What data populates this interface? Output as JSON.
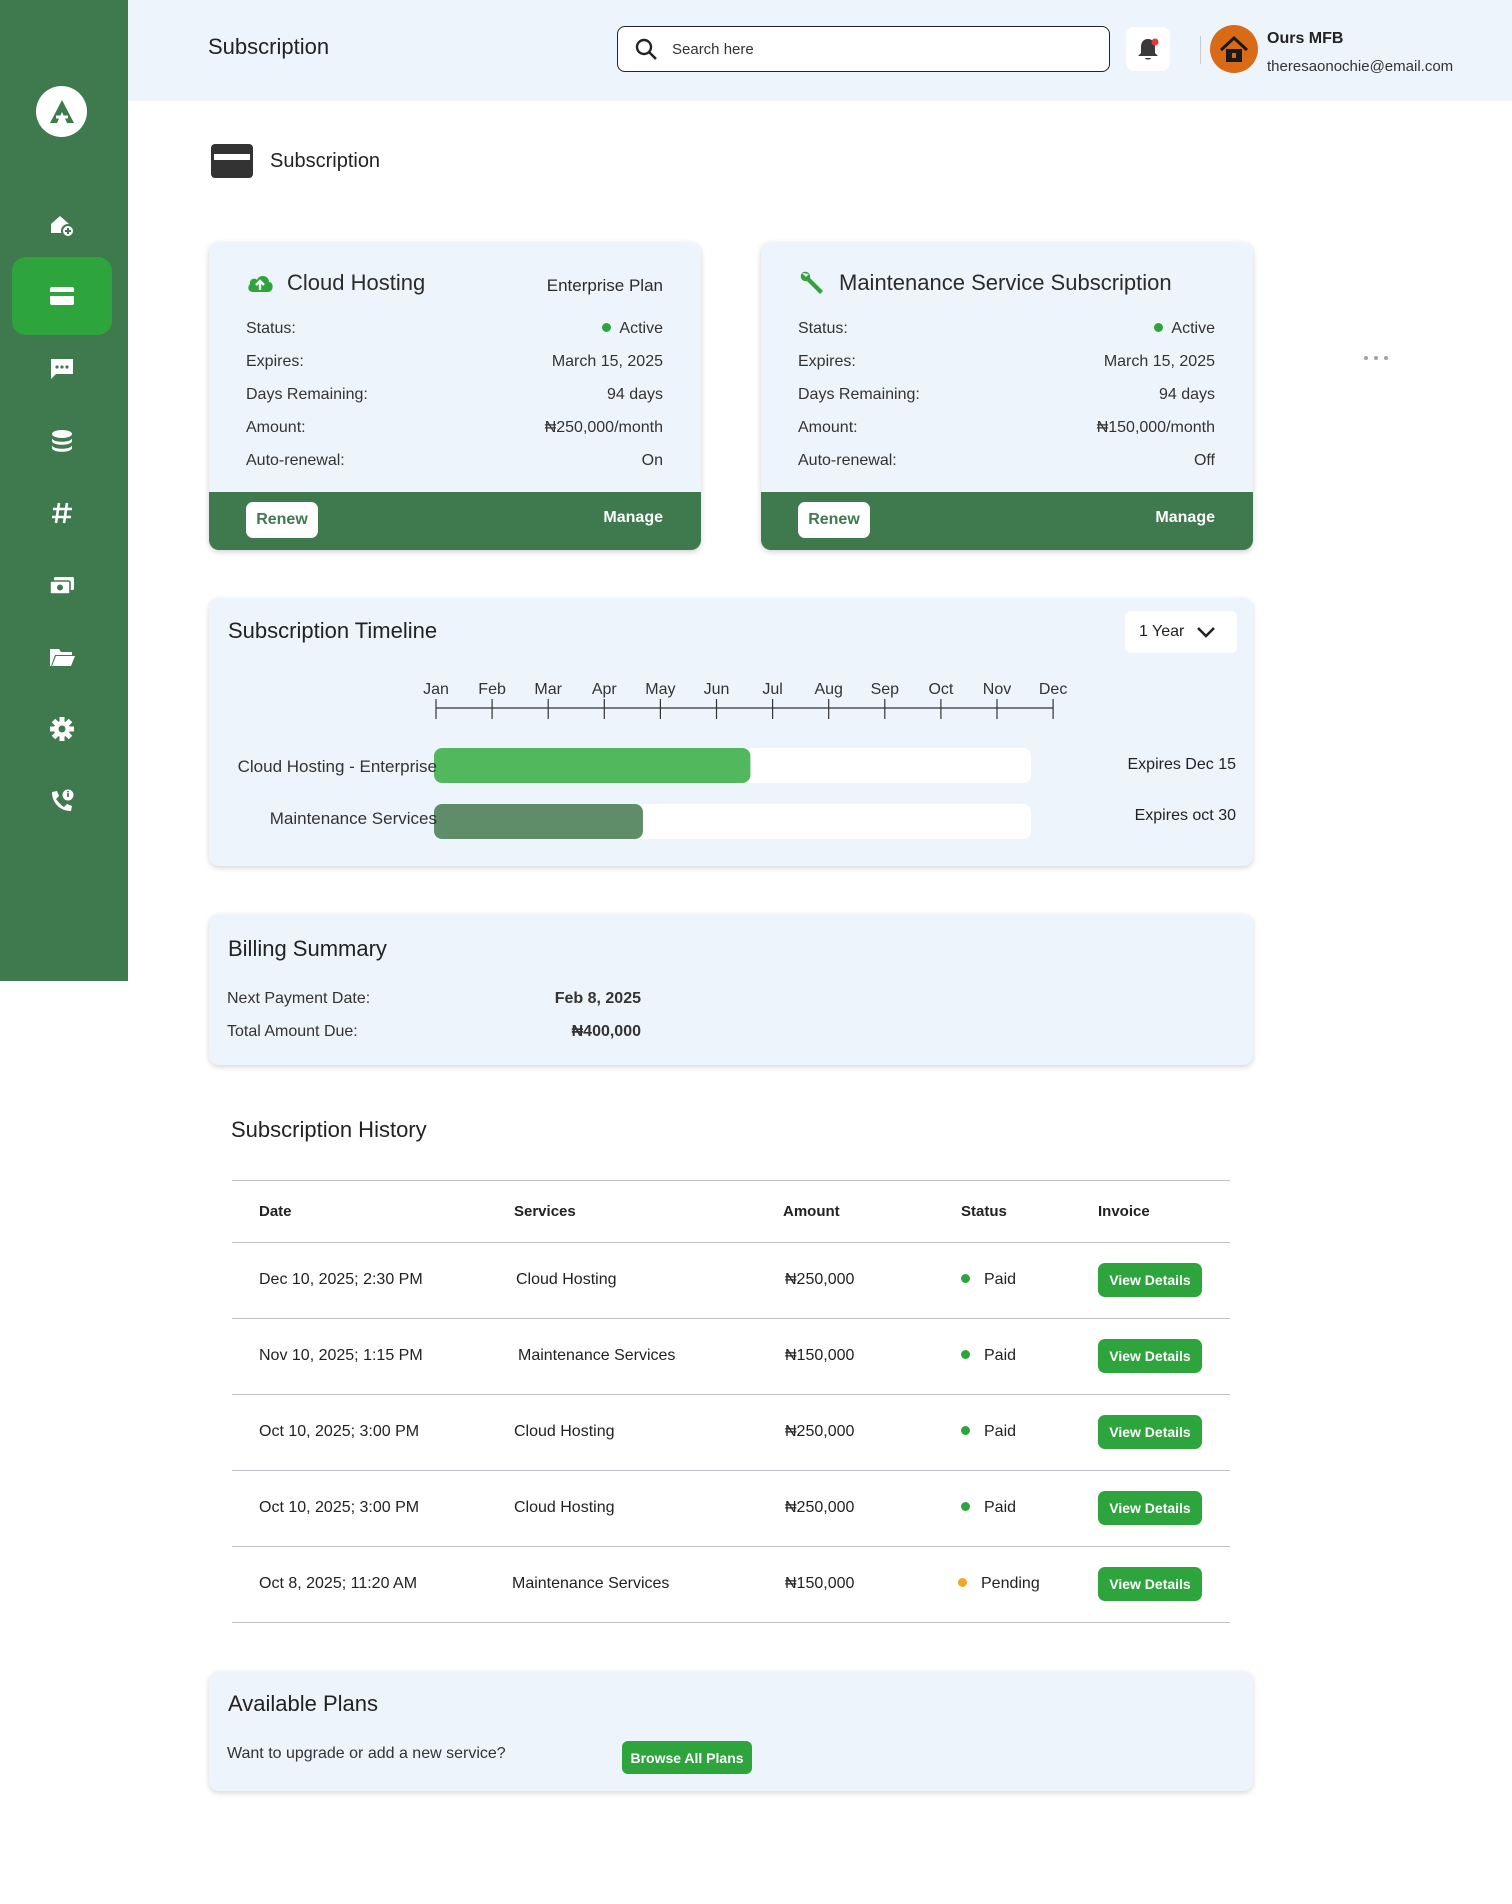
{
  "header": {
    "title": "Subscription",
    "search_placeholder": "Search here",
    "user_name": "Ours MFB",
    "user_email": "theresaonochie@email.com"
  },
  "sidebar": {
    "items": [
      {
        "icon": "home-add-icon",
        "active": false
      },
      {
        "icon": "credit-card-icon",
        "active": true
      },
      {
        "icon": "chat-icon",
        "active": false
      },
      {
        "icon": "database-icon",
        "active": false
      },
      {
        "icon": "hashtag-icon",
        "active": false
      },
      {
        "icon": "money-icon",
        "active": false
      },
      {
        "icon": "folder-icon",
        "active": false
      },
      {
        "icon": "settings-icon",
        "active": false
      },
      {
        "icon": "phone-info-icon",
        "active": false
      }
    ]
  },
  "page": {
    "heading": "Subscription"
  },
  "cards": [
    {
      "icon": "cloud-upload-icon",
      "title": "Cloud Hosting",
      "plan": "Enterprise Plan",
      "rows": [
        {
          "label": "Status:",
          "value": "Active"
        },
        {
          "label": "Expires:",
          "value": "March 15, 2025"
        },
        {
          "label": "Days Remaining:",
          "value": "94 days"
        },
        {
          "label": "Amount:",
          "value": "₦250,000/month"
        },
        {
          "label": "Auto-renewal:",
          "value": "On"
        }
      ],
      "renew_label": "Renew",
      "manage_label": "Manage"
    },
    {
      "icon": "wrench-icon",
      "title": "Maintenance Service Subscription",
      "plan": "",
      "rows": [
        {
          "label": "Status:",
          "value": "Active"
        },
        {
          "label": "Expires:",
          "value": "March 15, 2025"
        },
        {
          "label": "Days Remaining:",
          "value": "94 days"
        },
        {
          "label": "Amount:",
          "value": "₦150,000/month"
        },
        {
          "label": "Auto-renewal:",
          "value": "Off"
        }
      ],
      "renew_label": "Renew",
      "manage_label": "Manage"
    }
  ],
  "timeline": {
    "title": "Subscription Timeline",
    "range_label": "1 Year",
    "months": [
      "Jan",
      "Feb",
      "Mar",
      "Apr",
      "May",
      "Jun",
      "Jul",
      "Aug",
      "Sep",
      "Oct",
      "Nov",
      "Dec"
    ],
    "bars": [
      {
        "label": "Cloud Hosting - Enterprise",
        "progress": 0.53,
        "color": "#52b85e",
        "expires": "Expires Dec 15"
      },
      {
        "label": "Maintenance Services",
        "progress": 0.35,
        "color": "#5f8d6a",
        "expires": "Expires oct 30"
      }
    ]
  },
  "billing": {
    "title": "Billing Summary",
    "next_payment_label": "Next Payment Date:",
    "next_payment_value": "Feb 8, 2025",
    "total_due_label": "Total Amount Due:",
    "total_due_value": "₦400,000"
  },
  "history": {
    "title": "Subscription History",
    "columns": [
      "Date",
      "Services",
      "Amount",
      "Status",
      "Invoice"
    ],
    "rows": [
      {
        "date": "Dec 10, 2025; 2:30 PM",
        "service": "Cloud Hosting",
        "amount": "₦250,000",
        "status": "Paid",
        "action": "View Details"
      },
      {
        "date": "Nov 10, 2025; 1:15 PM",
        "service": "Maintenance Services",
        "amount": "₦150,000",
        "status": "Paid",
        "action": "View Details"
      },
      {
        "date": "Oct 10, 2025; 3:00 PM",
        "service": "Cloud Hosting",
        "amount": "₦250,000",
        "status": "Paid",
        "action": "View Details"
      },
      {
        "date": "Oct 10, 2025; 3:00 PM",
        "service": "Cloud Hosting",
        "amount": "₦250,000",
        "status": "Paid",
        "action": "View Details"
      },
      {
        "date": "Oct 8, 2025; 11:20 AM",
        "service": "Maintenance Services",
        "amount": "₦150,000",
        "status": "Pending",
        "action": "View Details"
      }
    ],
    "status_colors": {
      "Paid": "#2ea43c",
      "Pending": "#f5a623"
    }
  },
  "plans": {
    "title": "Available Plans",
    "text": "Want to upgrade or add a new service?",
    "button_label": "Browse All Plans"
  },
  "colors": {
    "sidebar": "#3f7a4e",
    "accent": "#2ea43c",
    "panel_bg": "#eef4fb"
  }
}
